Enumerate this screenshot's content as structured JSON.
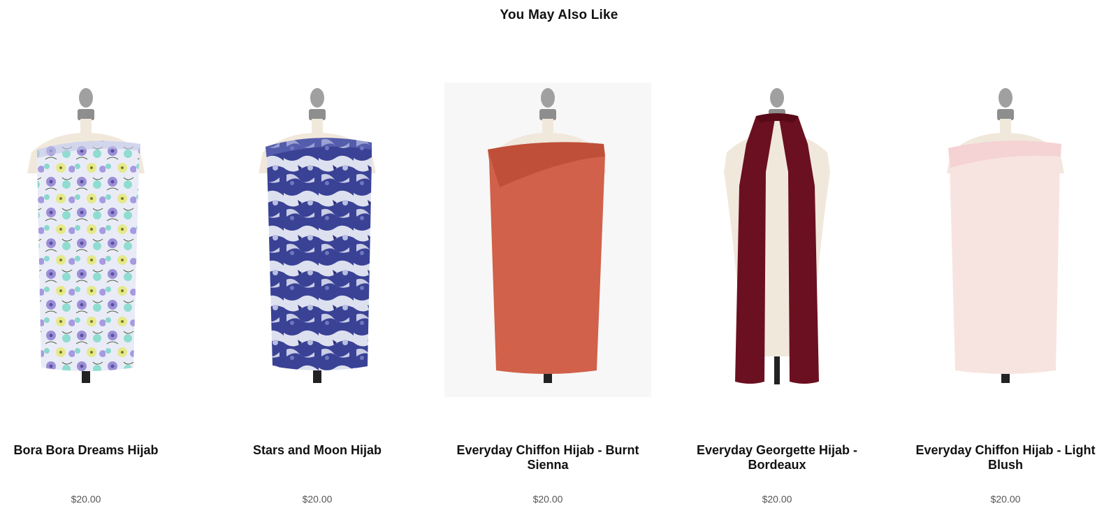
{
  "section": {
    "title": "You May Also Like"
  },
  "products": [
    {
      "name": "Bora Bora Dreams Hijab",
      "price": "$20.00",
      "style": "draped",
      "color": "#d9dcf0",
      "pattern": "floral"
    },
    {
      "name": "Stars and Moon Hijab",
      "price": "$20.00",
      "style": "draped",
      "color": "#3d4596",
      "pattern": "marble"
    },
    {
      "name": "Everyday Chiffon Hijab - Burnt Sienna",
      "price": "$20.00",
      "style": "draped",
      "color": "#cf6048",
      "pattern": "solid"
    },
    {
      "name": "Everyday Georgette Hijab - Bordeaux",
      "price": "$20.00",
      "style": "scarf",
      "color": "#6b1020",
      "pattern": "solid"
    },
    {
      "name": "Everyday Chiffon Hijab - Light Blush",
      "price": "$20.00",
      "style": "draped",
      "color": "#f6e2de",
      "pattern": "solid"
    }
  ],
  "colors": {
    "text": "#111111",
    "price": "#555555",
    "mannequin_finial": "#9a9a9a",
    "mannequin_body": "#f1e8dc",
    "stand": "#222222"
  }
}
